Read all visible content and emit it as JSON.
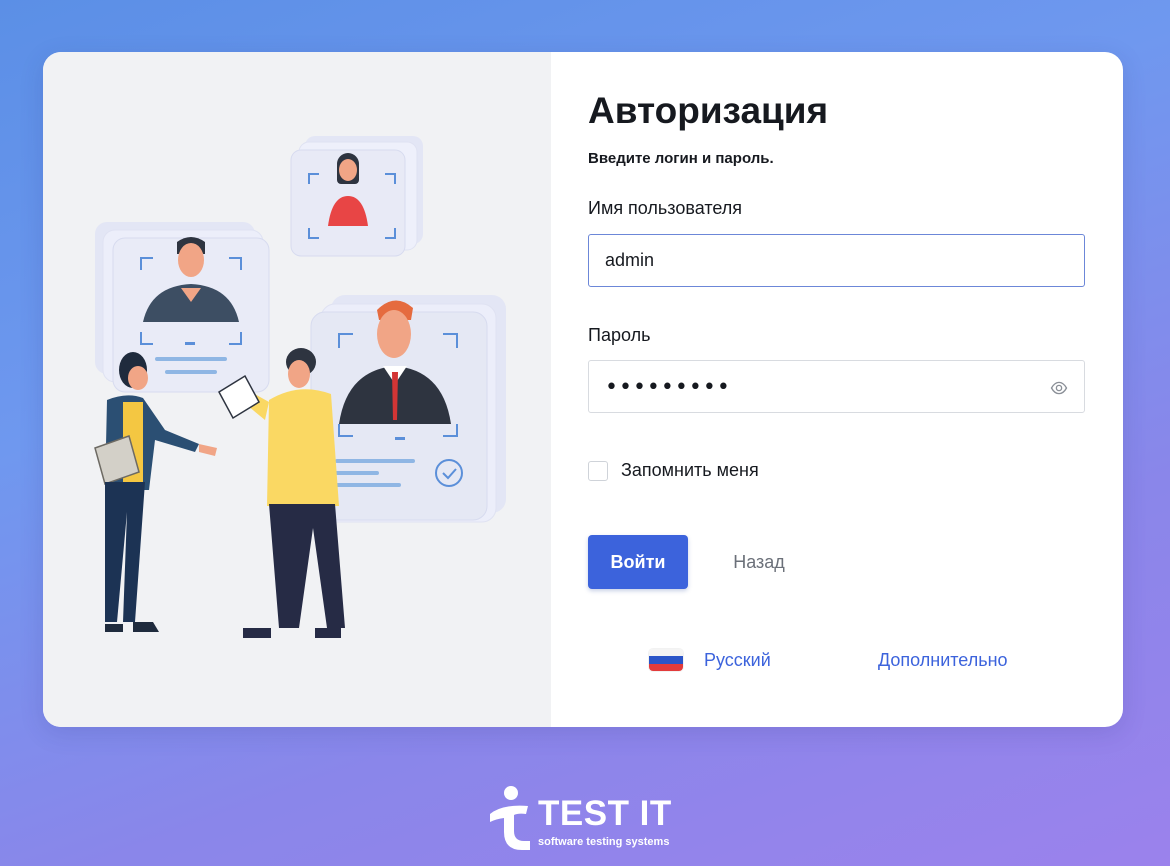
{
  "login": {
    "title": "Авторизация",
    "subtitle": "Введите логин и пароль.",
    "username_label": "Имя пользователя",
    "username_value": "admin",
    "password_label": "Пароль",
    "password_masked": "•••••••••",
    "remember_label": "Запомнить меня",
    "remember_checked": false,
    "submit_label": "Войти",
    "back_label": "Назад"
  },
  "footer": {
    "language_label": "Русский",
    "language_flag_icon": "russia-flag-icon",
    "more_label": "Дополнительно"
  },
  "brand": {
    "name": "TEST IT",
    "tagline": "software testing systems"
  },
  "icons": {
    "password_toggle": "eye-icon",
    "illustration": "people-profiles-illustration"
  },
  "colors": {
    "primary": "#3c63dc",
    "text": "#16191f",
    "muted": "#6b7079",
    "panel_bg": "#f1f2f4"
  }
}
